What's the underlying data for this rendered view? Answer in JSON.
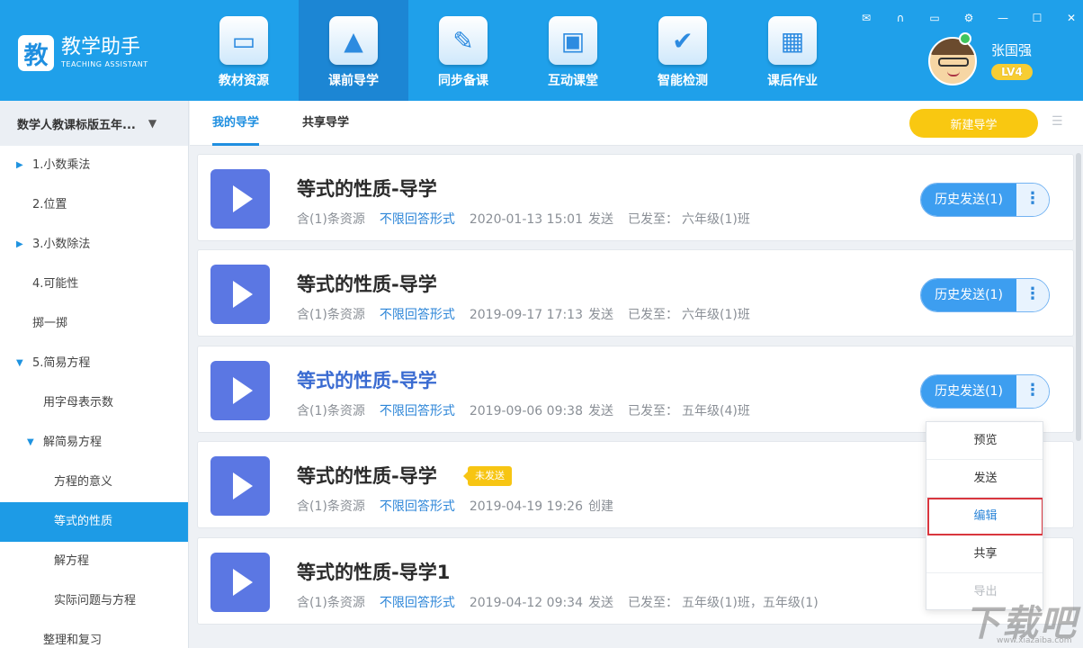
{
  "app": {
    "title": "教学助手",
    "subtitle": "TEACHING ASSISTANT",
    "logo_char": "教"
  },
  "nav": [
    {
      "label": "教材资源",
      "icon": "textbook-resource-icon",
      "glyph": "▭",
      "active": false
    },
    {
      "label": "课前导学",
      "icon": "pre-class-guide-icon",
      "glyph": "▲",
      "active": true
    },
    {
      "label": "同步备课",
      "icon": "lesson-prep-icon",
      "glyph": "✎",
      "active": false
    },
    {
      "label": "互动课堂",
      "icon": "interactive-class-icon",
      "glyph": "▣",
      "active": false
    },
    {
      "label": "智能检测",
      "icon": "smart-test-icon",
      "glyph": "✔",
      "active": false
    },
    {
      "label": "课后作业",
      "icon": "homework-icon",
      "glyph": "▦",
      "active": false
    }
  ],
  "window_controls": [
    {
      "name": "mail-icon",
      "glyph": "✉"
    },
    {
      "name": "headset-icon",
      "glyph": "∩"
    },
    {
      "name": "chat-icon",
      "glyph": "▭"
    },
    {
      "name": "settings-icon",
      "glyph": "⚙"
    },
    {
      "name": "minimize-icon",
      "glyph": "—"
    },
    {
      "name": "maximize-icon",
      "glyph": "☐"
    },
    {
      "name": "close-icon",
      "glyph": "✕"
    }
  ],
  "user": {
    "name": "张国强",
    "level": "LV4"
  },
  "sidebar": {
    "book": "数学人教课标版五年...",
    "items": [
      {
        "label": "1.小数乘法",
        "level": 0,
        "arrow": "▶",
        "active": false
      },
      {
        "label": "2.位置",
        "level": 0,
        "arrow": "",
        "active": false
      },
      {
        "label": "3.小数除法",
        "level": 0,
        "arrow": "▶",
        "active": false
      },
      {
        "label": "4.可能性",
        "level": 0,
        "arrow": "",
        "active": false
      },
      {
        "label": "掷一掷",
        "level": 0,
        "arrow": "",
        "active": false
      },
      {
        "label": "5.简易方程",
        "level": 0,
        "arrow": "▼",
        "active": false
      },
      {
        "label": "用字母表示数",
        "level": 1,
        "arrow": "",
        "active": false
      },
      {
        "label": "解简易方程",
        "level": 1,
        "arrow": "▼",
        "active": false
      },
      {
        "label": "方程的意义",
        "level": 2,
        "arrow": "",
        "active": false
      },
      {
        "label": "等式的性质",
        "level": 2,
        "arrow": "",
        "active": true
      },
      {
        "label": "解方程",
        "level": 2,
        "arrow": "",
        "active": false
      },
      {
        "label": "实际问题与方程",
        "level": 2,
        "arrow": "",
        "active": false
      },
      {
        "label": "整理和复习",
        "level": 1,
        "arrow": "",
        "active": false
      }
    ]
  },
  "tabs": [
    {
      "label": "我的导学",
      "active": true
    },
    {
      "label": "共享导学",
      "active": false
    }
  ],
  "new_button": "新建导学",
  "cards": [
    {
      "title": "等式的性质-导学",
      "highlight": false,
      "tag": "",
      "resources": "含(1)条资源",
      "answer_mode": "不限回答形式",
      "datetime": "2020-01-13 15:01",
      "action": "发送",
      "sent_to_label": "已发至：",
      "sent_to": "六年级(1)班",
      "history": "历史发送(1)"
    },
    {
      "title": "等式的性质-导学",
      "highlight": false,
      "tag": "",
      "resources": "含(1)条资源",
      "answer_mode": "不限回答形式",
      "datetime": "2019-09-17 17:13",
      "action": "发送",
      "sent_to_label": "已发至：",
      "sent_to": "六年级(1)班",
      "history": "历史发送(1)"
    },
    {
      "title": "等式的性质-导学",
      "highlight": true,
      "tag": "",
      "resources": "含(1)条资源",
      "answer_mode": "不限回答形式",
      "datetime": "2019-09-06 09:38",
      "action": "发送",
      "sent_to_label": "已发至：",
      "sent_to": "五年级(4)班",
      "history": "历史发送(1)"
    },
    {
      "title": "等式的性质-导学",
      "highlight": false,
      "tag": "未发送",
      "resources": "含(1)条资源",
      "answer_mode": "不限回答形式",
      "datetime": "2019-04-19 19:26",
      "action": "创建",
      "sent_to_label": "",
      "sent_to": "",
      "history": ""
    },
    {
      "title": "等式的性质-导学1",
      "highlight": false,
      "tag": "",
      "resources": "含(1)条资源",
      "answer_mode": "不限回答形式",
      "datetime": "2019-04-12 09:34",
      "action": "发送",
      "sent_to_label": "已发至：",
      "sent_to": "五年级(1)班，五年级(1)",
      "history": ""
    }
  ],
  "dropdown": [
    {
      "label": "预览",
      "state": "normal"
    },
    {
      "label": "发送",
      "state": "normal"
    },
    {
      "label": "编辑",
      "state": "highlighted"
    },
    {
      "label": "共享",
      "state": "normal"
    },
    {
      "label": "导出",
      "state": "faded"
    }
  ],
  "more_glyph": "⋮",
  "watermark": {
    "text": "下载吧",
    "sub": "www.xiazaiba.com"
  },
  "colors": {
    "topbar": "#1fa0ea",
    "active_nav": "#1c86d4",
    "new_button": "#f9c811",
    "play_tile": "#5b77e3",
    "history_button": "#3d9ef0",
    "highlight_border": "#d9363e"
  }
}
